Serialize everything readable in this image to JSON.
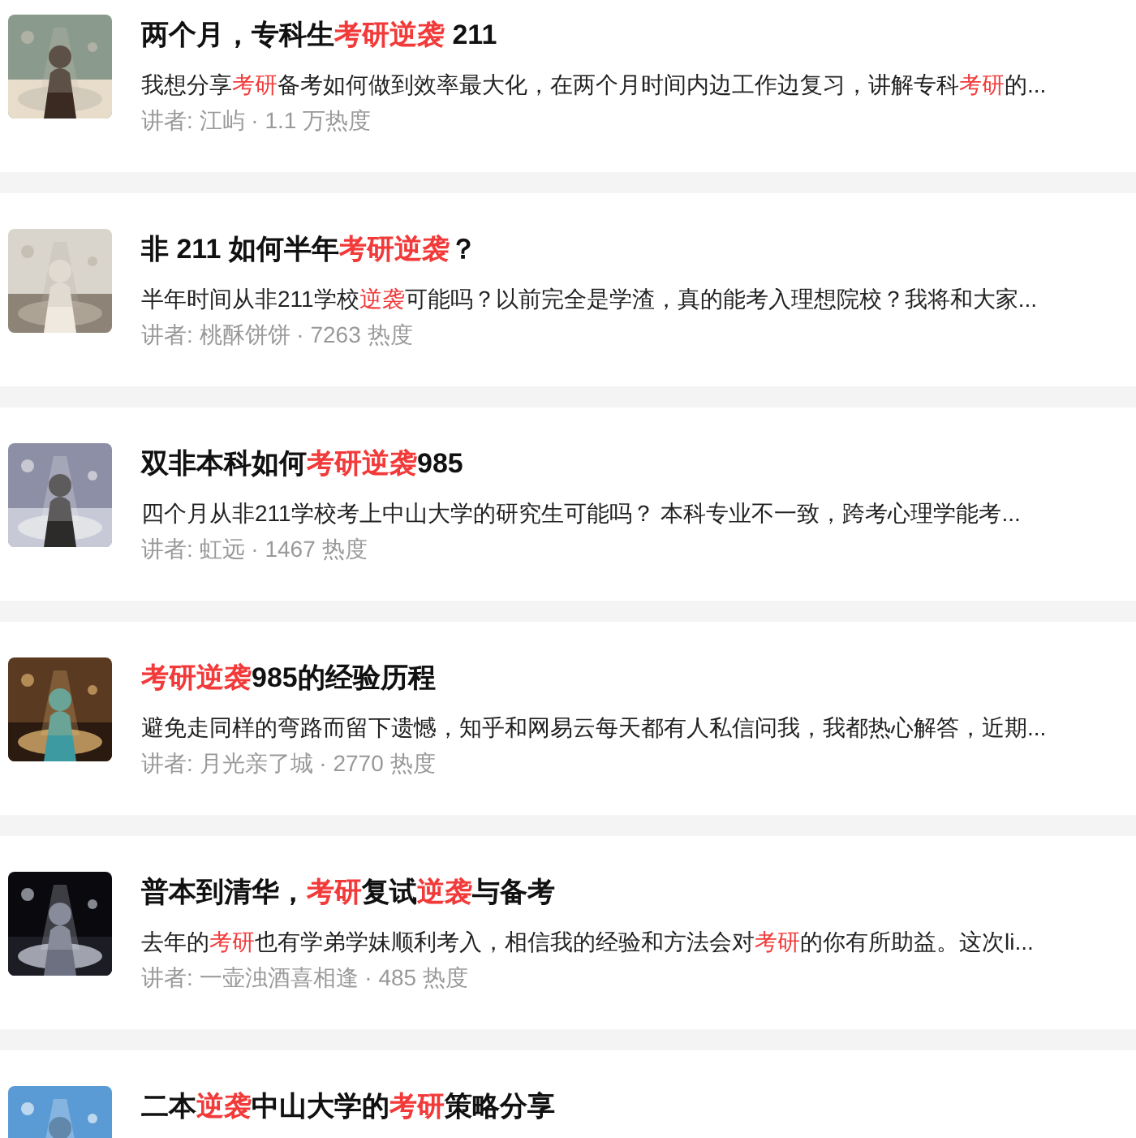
{
  "courses": [
    {
      "thumbnail": {
        "kind": "picture"
      },
      "title": [
        {
          "text": "两个月，专科生",
          "highlight": false
        },
        {
          "text": "考研逆袭",
          "highlight": true
        },
        {
          "text": " 211",
          "highlight": false
        }
      ],
      "description": [
        {
          "text": "我想分享",
          "highlight": false
        },
        {
          "text": "考研",
          "highlight": true
        },
        {
          "text": "备考如何做到效率最大化，在两个月时间内边工作边复习，讲解专科",
          "highlight": false
        },
        {
          "text": "考研",
          "highlight": true
        },
        {
          "text": "的...",
          "highlight": false
        }
      ],
      "meta": "讲者: 江屿 · 1.1 万热度"
    },
    {
      "thumbnail": {
        "kind": "picture"
      },
      "title": [
        {
          "text": "非 211 如何半年",
          "highlight": false
        },
        {
          "text": "考研逆袭",
          "highlight": true
        },
        {
          "text": "？",
          "highlight": false
        }
      ],
      "description": [
        {
          "text": "半年时间从非211学校",
          "highlight": false
        },
        {
          "text": "逆袭",
          "highlight": true
        },
        {
          "text": "可能吗？以前完全是学渣，真的能考入理想院校？我将和大家...",
          "highlight": false
        }
      ],
      "meta": "讲者: 桃酥饼饼 · 7263 热度"
    },
    {
      "thumbnail": {
        "kind": "picture"
      },
      "title": [
        {
          "text": "双非本科如何",
          "highlight": false
        },
        {
          "text": "考研逆袭",
          "highlight": true
        },
        {
          "text": "985",
          "highlight": false
        }
      ],
      "description": [
        {
          "text": "四个月从非211学校考上中山大学的研究生可能吗？ 本科专业不一致，跨考心理学能考...",
          "highlight": false
        }
      ],
      "meta": "讲者: 虹远 · 1467 热度"
    },
    {
      "thumbnail": {
        "kind": "picture"
      },
      "title": [
        {
          "text": "考研逆袭",
          "highlight": true
        },
        {
          "text": "985的经验历程",
          "highlight": false
        }
      ],
      "description": [
        {
          "text": "避免走同样的弯路而留下遗憾，知乎和网易云每天都有人私信问我，我都热心解答，近期...",
          "highlight": false
        }
      ],
      "meta": "讲者: 月光亲了城 · 2770 热度"
    },
    {
      "thumbnail": {
        "kind": "picture"
      },
      "title": [
        {
          "text": "普本到清华，",
          "highlight": false
        },
        {
          "text": "考研",
          "highlight": true
        },
        {
          "text": "复试",
          "highlight": false
        },
        {
          "text": "逆袭",
          "highlight": true
        },
        {
          "text": "与备考",
          "highlight": false
        }
      ],
      "description": [
        {
          "text": "去年的",
          "highlight": false
        },
        {
          "text": "考研",
          "highlight": true
        },
        {
          "text": "也有学弟学妹顺利考入，相信我的经验和方法会对",
          "highlight": false
        },
        {
          "text": "考研",
          "highlight": true
        },
        {
          "text": "的你有所助益。这次li...",
          "highlight": false
        }
      ],
      "meta": "讲者: 一壶浊酒喜相逢 · 485 热度"
    },
    {
      "thumbnail": {
        "kind": "picture"
      },
      "title": [
        {
          "text": "二本",
          "highlight": false
        },
        {
          "text": "逆袭",
          "highlight": true
        },
        {
          "text": "中山大学的",
          "highlight": false
        },
        {
          "text": "考研",
          "highlight": true
        },
        {
          "text": "策略分享",
          "highlight": false
        }
      ]
    }
  ]
}
